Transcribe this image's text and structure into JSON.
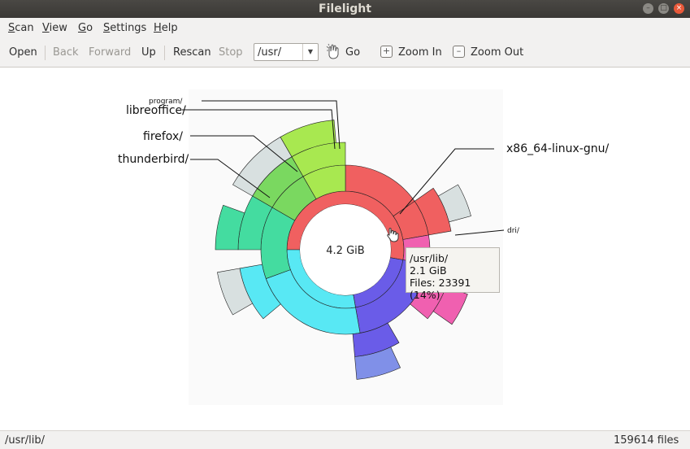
{
  "window": {
    "title": "Filelight"
  },
  "menubar": [
    {
      "pre": "",
      "key": "S",
      "post": "can"
    },
    {
      "pre": "",
      "key": "V",
      "post": "iew"
    },
    {
      "pre": "",
      "key": "G",
      "post": "o"
    },
    {
      "pre": "",
      "key": "S",
      "post": "ettings"
    },
    {
      "pre": "",
      "key": "H",
      "post": "elp"
    }
  ],
  "toolbar": {
    "open": "Open",
    "back": "Back",
    "forward": "Forward",
    "up": "Up",
    "rescan": "Rescan",
    "stop": "Stop",
    "path_value": "/usr/",
    "go": "Go",
    "zoom_in": "Zoom In",
    "zoom_out": "Zoom Out"
  },
  "chart": {
    "center_label": "4.2 GiB",
    "labels": {
      "program": "program/",
      "libreoffice": "libreoffice/",
      "firefox": "firefox/",
      "thunderbird": "thunderbird/",
      "x86": "x86_64-linux-gnu/",
      "dri": "dri/"
    }
  },
  "tooltip": {
    "path": "/usr/lib/",
    "size": "2.1 GiB",
    "files": "Files: 23391 (14%)"
  },
  "statusbar": {
    "path": "/usr/lib/",
    "files": "159614 files"
  },
  "colors": {
    "lib": "#f06060",
    "share": "#58e8f4",
    "bin": "#6a5ce8",
    "green": "#7ad860",
    "teal": "#44dca0",
    "pink": "#f060b0",
    "grey": "#d8e0e0"
  }
}
